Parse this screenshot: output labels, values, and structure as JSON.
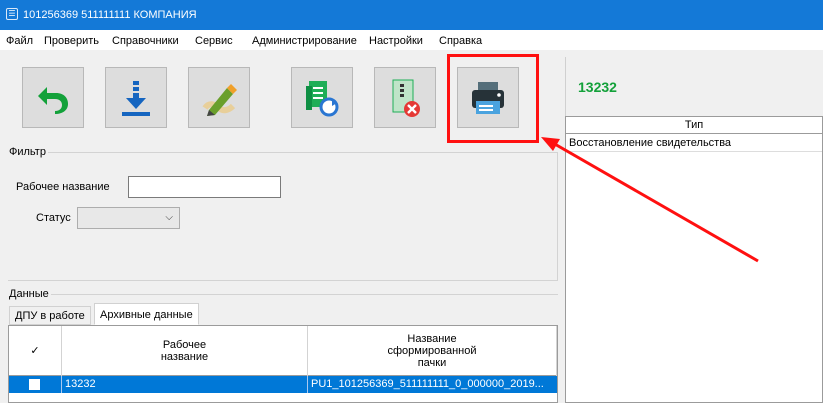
{
  "window": {
    "title": "101256369 511111111 КОМПАНИЯ",
    "app_icon": "app-window-icon"
  },
  "menu": {
    "items": [
      "Файл",
      "Проверить",
      "Справочники",
      "Сервис",
      "Администрирование",
      "Настройки",
      "Справка"
    ]
  },
  "toolbar": {
    "buttons": [
      {
        "name": "undo-icon",
        "color": "#13a13a"
      },
      {
        "name": "download-icon",
        "color": "#1565c0"
      },
      {
        "name": "edit-pencil-icon",
        "color": "#f0a02a"
      },
      {
        "name": "document-refresh-icon",
        "color": "#1fae57"
      },
      {
        "name": "document-delete-icon",
        "color": "#e53935"
      },
      {
        "name": "printer-icon",
        "color": "#37474f"
      }
    ],
    "highlight_color": "#ff1010"
  },
  "filter": {
    "group_label": "Фильтр",
    "work_name_label": "Рабочее название",
    "work_name_value": "",
    "status_label": "Статус",
    "status_value": ""
  },
  "data": {
    "group_label": "Данные",
    "tabs": [
      "ДПУ в работе",
      "Архивные данные"
    ],
    "active_tab": 1,
    "columns": [
      {
        "label": "✓"
      },
      {
        "label": "Рабочее\nназвание"
      },
      {
        "label": "Название\nсформированной\nпачки"
      }
    ],
    "rows": [
      {
        "checked": false,
        "work_name": "13232",
        "pack_name": "PU1_101256369_511111111_0_000000_2019..."
      }
    ],
    "selection_color": "#0078d7"
  },
  "details": {
    "code": "13232",
    "type_header": "Тип",
    "type_value": "Восстановление свидетельства"
  }
}
